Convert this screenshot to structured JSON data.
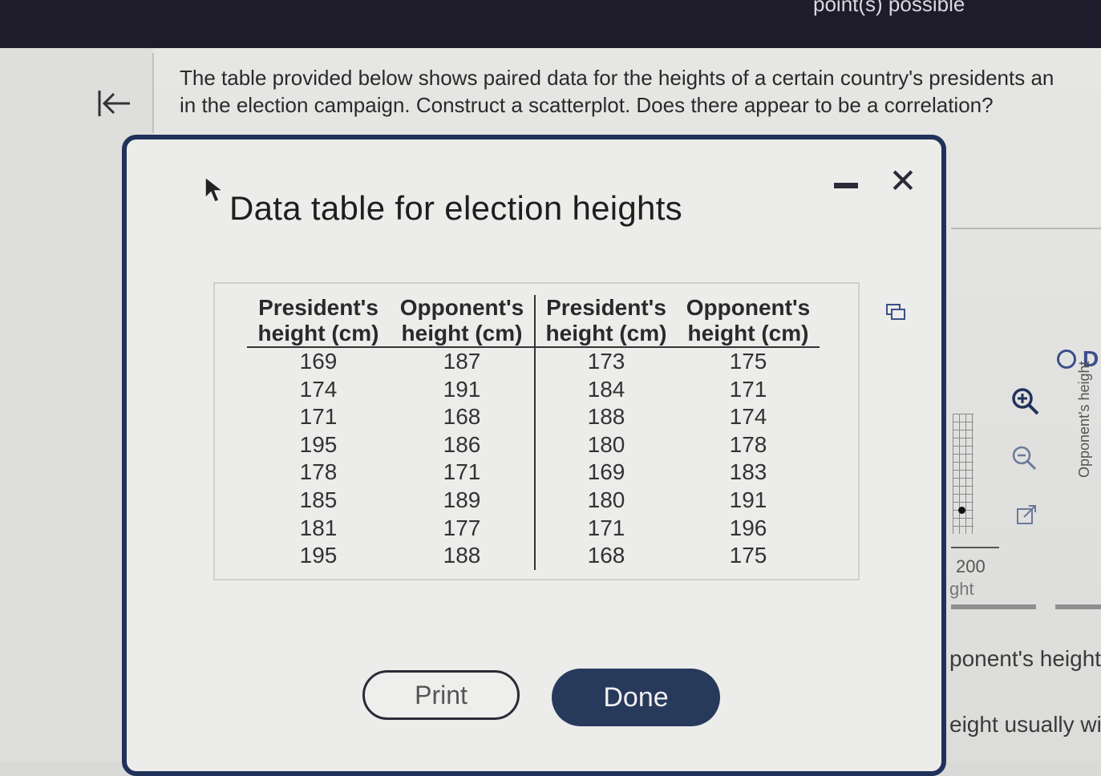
{
  "header": {
    "points_text": "point(s) possible"
  },
  "question": {
    "line1": "The table provided below shows paired data for the heights of a certain country's presidents an",
    "line2": "in the election campaign. Construct a scatterplot. Does there appear to be a correlation?"
  },
  "dialog": {
    "title": "Data table for election heights",
    "close_glyph": "✕",
    "columns": [
      {
        "line1": "President's",
        "line2": "height (cm)"
      },
      {
        "line1": "Opponent's",
        "line2": "height (cm)"
      },
      {
        "line1": "President's",
        "line2": "height (cm)"
      },
      {
        "line1": "Opponent's",
        "line2": "height (cm)"
      }
    ],
    "rows": [
      [
        "169",
        "187",
        "173",
        "175"
      ],
      [
        "174",
        "191",
        "184",
        "171"
      ],
      [
        "171",
        "168",
        "188",
        "174"
      ],
      [
        "195",
        "186",
        "180",
        "178"
      ],
      [
        "178",
        "171",
        "169",
        "183"
      ],
      [
        "185",
        "189",
        "180",
        "191"
      ],
      [
        "181",
        "177",
        "171",
        "196"
      ],
      [
        "195",
        "188",
        "168",
        "175"
      ]
    ],
    "print_label": "Print",
    "done_label": "Done"
  },
  "right_panel": {
    "tick_label": "200",
    "axis_fragment": "ght",
    "radio_letter": "D",
    "vertical_axis_label": "Opponent's height",
    "fragment1": "ponent's height'",
    "fragment2": "eight usually wi"
  },
  "icons": {
    "back": "arrow-left-to-bar-icon",
    "cursor": "mouse-pointer-icon",
    "copy": "copy-icon",
    "zoom_in": "zoom-in-icon",
    "zoom_out": "zoom-out-icon",
    "popout": "external-link-icon"
  },
  "colors": {
    "topbar": "#1e1b2b",
    "dialog_border": "#20325a",
    "done_button": "#283a5c",
    "radio_accent": "#3a4f8a"
  }
}
